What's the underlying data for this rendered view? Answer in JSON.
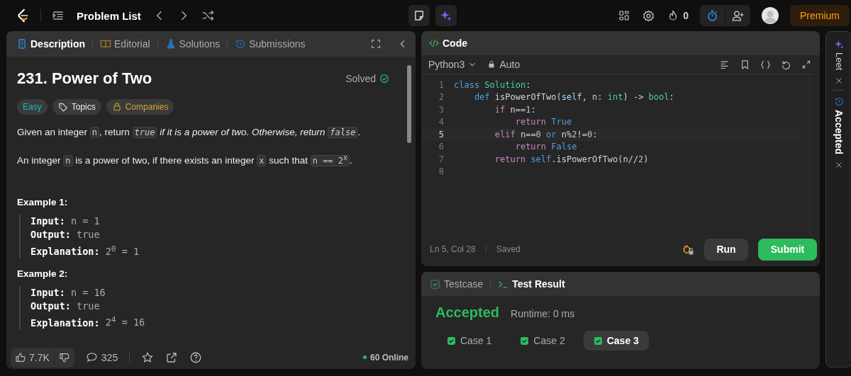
{
  "topbar": {
    "title": "Problem List",
    "streak": "0",
    "premium": "Premium"
  },
  "description": {
    "tabs": [
      {
        "label": "Description",
        "kind": "doc",
        "selected": true
      },
      {
        "label": "Editorial",
        "kind": "book",
        "selected": false
      },
      {
        "label": "Solutions",
        "kind": "flask",
        "selected": false
      },
      {
        "label": "Submissions",
        "kind": "history",
        "selected": false
      }
    ],
    "title": "231. Power of Two",
    "status": "Solved",
    "tags": [
      {
        "label": "Easy",
        "kind": "difficulty"
      },
      {
        "label": "Topics",
        "kind": "topics"
      },
      {
        "label": "Companies",
        "kind": "companies"
      }
    ],
    "paragraphs": [
      [
        {
          "text": "Given an integer ",
          "kind": "text"
        },
        {
          "text": "n",
          "kind": "code"
        },
        {
          "text": ", return ",
          "kind": "text"
        },
        {
          "text": "true",
          "kind": "icode"
        },
        {
          "text": " if it is a power of two. Otherwise, return ",
          "kind": "italic"
        },
        {
          "text": "false",
          "kind": "icode"
        },
        {
          "text": ".",
          "kind": "text"
        }
      ],
      [
        {
          "text": "An integer ",
          "kind": "text"
        },
        {
          "text": "n",
          "kind": "code"
        },
        {
          "text": " is a power of two, if there exists an integer ",
          "kind": "text"
        },
        {
          "text": "x",
          "kind": "code"
        },
        {
          "text": " such that ",
          "kind": "text"
        },
        {
          "text": "n == 2$^{x}$",
          "kind": "code"
        },
        {
          "text": ".",
          "kind": "text"
        }
      ]
    ],
    "examples": [
      {
        "title": "Example 1:",
        "lines": [
          {
            "label": "Input:",
            "value": "n = 1"
          },
          {
            "label": "Output:",
            "value": "true"
          },
          {
            "label": "Explanation:",
            "value": "2$^{0}$ = 1"
          }
        ]
      },
      {
        "title": "Example 2:",
        "lines": [
          {
            "label": "Input:",
            "value": "n = 16"
          },
          {
            "label": "Output:",
            "value": "true"
          },
          {
            "label": "Explanation:",
            "value": "2$^{4}$ = 16"
          }
        ]
      }
    ],
    "footer": {
      "likes": "7.7K",
      "comments": "325",
      "online": "60 Online"
    }
  },
  "code": {
    "title": "Code",
    "language": "Python3",
    "mode": "Auto",
    "lines": [
      {
        "number": "1",
        "current": false,
        "tokens": [
          {
            "text": "class",
            "kind": "kw"
          },
          {
            "text": " Solution",
            "kind": "cls"
          },
          {
            "text": ":",
            "kind": "plain"
          }
        ]
      },
      {
        "number": "2",
        "current": false,
        "tokens": [
          {
            "text": "    def",
            "kind": "kw"
          },
          {
            "text": " isPowerOfTwo(",
            "kind": "plain"
          },
          {
            "text": "self",
            "kind": "var"
          },
          {
            "text": ", ",
            "kind": "plain"
          },
          {
            "text": "n",
            "kind": "var"
          },
          {
            "text": ": ",
            "kind": "plain"
          },
          {
            "text": "int",
            "kind": "cls"
          },
          {
            "text": ") -> ",
            "kind": "plain"
          },
          {
            "text": "bool",
            "kind": "cls"
          },
          {
            "text": ":",
            "kind": "plain"
          }
        ]
      },
      {
        "number": "3",
        "current": false,
        "tokens": [
          {
            "text": "        if",
            "kind": "ctrl"
          },
          {
            "text": " n==",
            "kind": "plain"
          },
          {
            "text": "1",
            "kind": "num"
          },
          {
            "text": ":",
            "kind": "plain"
          }
        ]
      },
      {
        "number": "4",
        "current": false,
        "tokens": [
          {
            "text": "            return",
            "kind": "ctrl"
          },
          {
            "text": " True",
            "kind": "kw"
          }
        ]
      },
      {
        "number": "5",
        "current": true,
        "tokens": [
          {
            "text": "        elif",
            "kind": "ctrl"
          },
          {
            "text": " n==",
            "kind": "plain"
          },
          {
            "text": "0",
            "kind": "num"
          },
          {
            "text": " or",
            "kind": "kw"
          },
          {
            "text": " n%",
            "kind": "plain"
          },
          {
            "text": "2",
            "kind": "num"
          },
          {
            "text": "!=",
            "kind": "plain"
          },
          {
            "text": "0",
            "kind": "num"
          },
          {
            "text": ":",
            "kind": "plain"
          }
        ]
      },
      {
        "number": "6",
        "current": false,
        "tokens": [
          {
            "text": "            return",
            "kind": "ctrl"
          },
          {
            "text": " False",
            "kind": "kw"
          }
        ]
      },
      {
        "number": "7",
        "current": false,
        "tokens": [
          {
            "text": "        return",
            "kind": "ctrl"
          },
          {
            "text": " self",
            "kind": "kw"
          },
          {
            "text": ".isPowerOfTwo(n//",
            "kind": "plain"
          },
          {
            "text": "2",
            "kind": "num"
          },
          {
            "text": ")",
            "kind": "plain"
          }
        ]
      },
      {
        "number": "8",
        "current": false
      }
    ],
    "position": "Ln 5, Col 28",
    "save_state": "Saved",
    "run": "Run",
    "submit": "Submit"
  },
  "result": {
    "tabs": [
      {
        "label": "Testcase",
        "kind": "check",
        "selected": false
      },
      {
        "label": "Test Result",
        "kind": "terminal",
        "selected": true
      }
    ],
    "verdict": "Accepted",
    "runtime": "Runtime: 0 ms",
    "cases": [
      {
        "label": "Case 1",
        "passed": true,
        "selected": false
      },
      {
        "label": "Case 2",
        "passed": true,
        "selected": false
      },
      {
        "label": "Case 3",
        "passed": true,
        "selected": true
      }
    ]
  },
  "side": {
    "tabs": [
      {
        "label": "Leet",
        "kind": "sparkle"
      },
      {
        "label": "Accepted",
        "kind": "history"
      }
    ]
  }
}
